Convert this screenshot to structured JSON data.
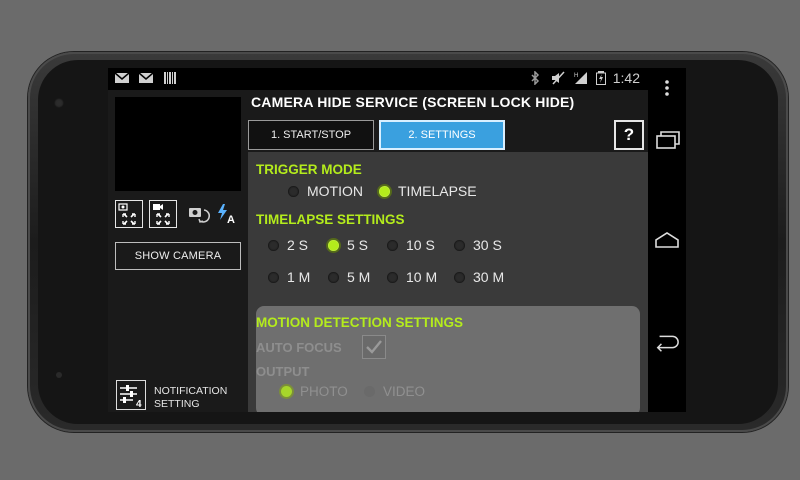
{
  "status_bar": {
    "time": "1:42",
    "left_icons": [
      "mail-icon",
      "mail-icon",
      "barcode-icon"
    ],
    "right_icons": [
      "bluetooth-icon",
      "mute-icon",
      "signal-h-icon",
      "battery-icon"
    ]
  },
  "nav_bar": {
    "buttons": [
      "overflow-menu-icon",
      "recent-apps-icon",
      "home-icon",
      "back-icon"
    ]
  },
  "left_panel": {
    "show_camera_label": "SHOW CAMERA",
    "notification_label_line1": "NOTIFICATION",
    "notification_label_line2": "SETTING",
    "notification_badge": "4"
  },
  "header": {
    "title": "CAMERA HIDE SERVICE (SCREEN LOCK HIDE)",
    "tabs": [
      {
        "label": "1. START/STOP",
        "active": false
      },
      {
        "label": "2. SETTINGS",
        "active": true
      }
    ],
    "help_label": "?"
  },
  "trigger_mode": {
    "heading": "TRIGGER MODE",
    "options": [
      {
        "label": "MOTION",
        "selected": false
      },
      {
        "label": "TIMELAPSE",
        "selected": true
      }
    ]
  },
  "timelapse_settings": {
    "heading": "TIMELAPSE SETTINGS",
    "row1": [
      {
        "label": "2 S",
        "selected": false
      },
      {
        "label": "5 S",
        "selected": true
      },
      {
        "label": "10 S",
        "selected": false
      },
      {
        "label": "30 S",
        "selected": false
      }
    ],
    "row2": [
      {
        "label": "1 M",
        "selected": false
      },
      {
        "label": "5 M",
        "selected": false
      },
      {
        "label": "10 M",
        "selected": false
      },
      {
        "label": "30 M",
        "selected": false
      }
    ]
  },
  "motion_detection": {
    "heading": "MOTION DETECTION SETTINGS",
    "auto_focus_label": "AUTO FOCUS",
    "auto_focus_checked": true,
    "output_label": "OUTPUT",
    "output_options": [
      {
        "label": "PHOTO",
        "selected": true
      },
      {
        "label": "VIDEO",
        "selected": false
      }
    ]
  },
  "colors": {
    "accent_green": "#b4ec1c",
    "tab_active_blue": "#3aa0df"
  }
}
